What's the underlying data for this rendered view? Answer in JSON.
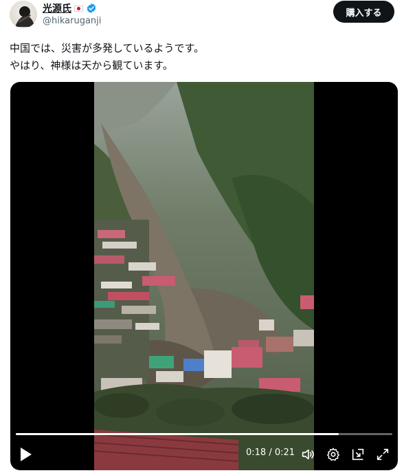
{
  "author": {
    "display_name": "光源氏",
    "handle": "@hikaruganji"
  },
  "actions": {
    "buy_label": "購入する"
  },
  "tweet": {
    "lines": [
      "中国では、災害が多発しているようです。",
      "やはり、神様は天から観ています。"
    ]
  },
  "video": {
    "current_time": "0:18",
    "duration": "0:21",
    "time_display": "0:18 / 0:21",
    "progress_fraction": 0.857
  },
  "icons": {
    "play": "play-icon",
    "volume": "volume-icon",
    "settings": "gear-icon",
    "pip": "picture-in-picture-icon",
    "fullscreen": "fullscreen-icon",
    "verified": "verified-badge-icon",
    "flag": "japan-flag-icon"
  },
  "colors": {
    "text": "#0f1419",
    "secondary": "#536471",
    "verified": "#1d9bf0",
    "button_bg": "#0f1419"
  }
}
